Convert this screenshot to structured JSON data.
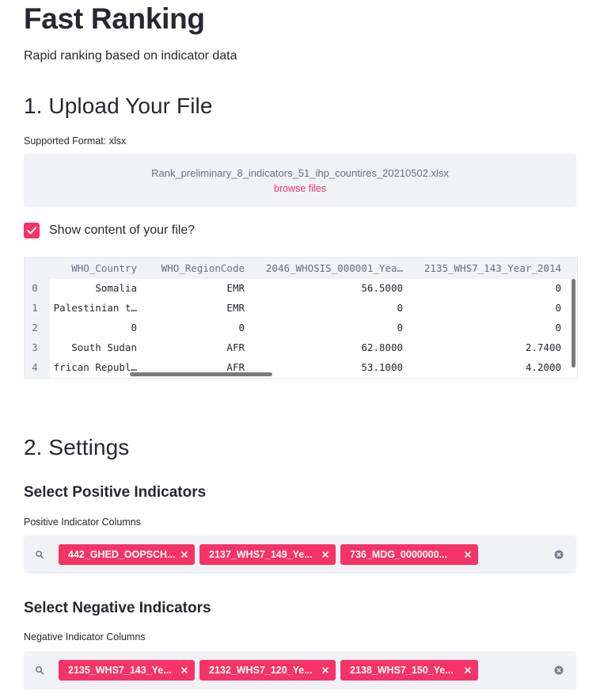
{
  "app": {
    "title": "Fast Ranking",
    "subtitle": "Rapid ranking based on indicator data"
  },
  "upload": {
    "heading": "1. Upload Your File",
    "format_label": "Supported Format: xlsx",
    "file_name": "Rank_preliminary_8_indicators_51_ihp_countires_20210502.xlsx",
    "browse_label": "browse files"
  },
  "show_content": {
    "label": "Show content of your file?",
    "checked": true
  },
  "table": {
    "columns": [
      "WHO_Country",
      "WHO_RegionCode",
      "2046_WHOSIS_000001_Yea…",
      "2135_WHS7_143_Year_2014"
    ],
    "rows": [
      {
        "index": "0",
        "cells": [
          "Somalia",
          "EMR",
          "56.5000",
          "0"
        ]
      },
      {
        "index": "1",
        "cells": [
          "Palestinian t…",
          "EMR",
          "0",
          "0"
        ]
      },
      {
        "index": "2",
        "cells": [
          "0",
          "0",
          "0",
          "0"
        ]
      },
      {
        "index": "3",
        "cells": [
          "South Sudan",
          "AFR",
          "62.8000",
          "2.7400"
        ]
      },
      {
        "index": "4",
        "cells": [
          "frican Republ…",
          "AFR",
          "53.1000",
          "4.2000"
        ]
      }
    ]
  },
  "settings": {
    "heading": "2. Settings",
    "positive": {
      "heading": "Select Positive Indicators",
      "label": "Positive Indicator Columns",
      "tags": [
        "442_GHED_OOPSCH...",
        "2137_WHS7_149_Ye...",
        "736_MDG_0000000..."
      ]
    },
    "negative": {
      "heading": "Select Negative Indicators",
      "label": "Negative Indicator Columns",
      "tags": [
        "2135_WHS7_143_Ye...",
        "2132_WHS7_120_Ye...",
        "2138_WHS7_150_Ye..."
      ]
    }
  },
  "colors": {
    "accent": "#f63366",
    "panel": "#f0f2f6",
    "text": "#262730"
  }
}
